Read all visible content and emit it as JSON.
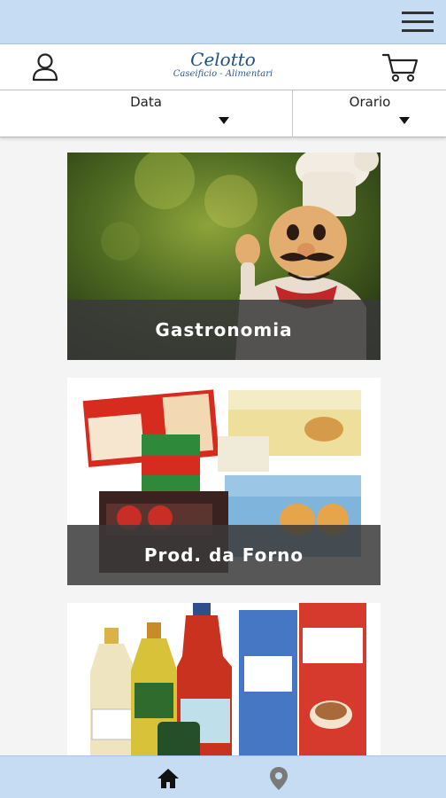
{
  "header": {
    "brand_name": "Celotto",
    "brand_subtitle": "Caseificio - Alimentari"
  },
  "filters": {
    "data_label": "Data",
    "orario_label": "Orario"
  },
  "categories": [
    {
      "label": "Gastronomia"
    },
    {
      "label": "Prod. da Forno"
    },
    {
      "label": ""
    }
  ],
  "icons": {
    "menu": "hamburger-menu-icon",
    "user": "user-icon",
    "cart": "shopping-cart-icon",
    "home": "home-icon",
    "location": "location-pin-icon"
  },
  "colors": {
    "bar_background": "#c6dcf3",
    "brand_text": "#1f4f8a",
    "overlay": "#3a3a3a"
  }
}
